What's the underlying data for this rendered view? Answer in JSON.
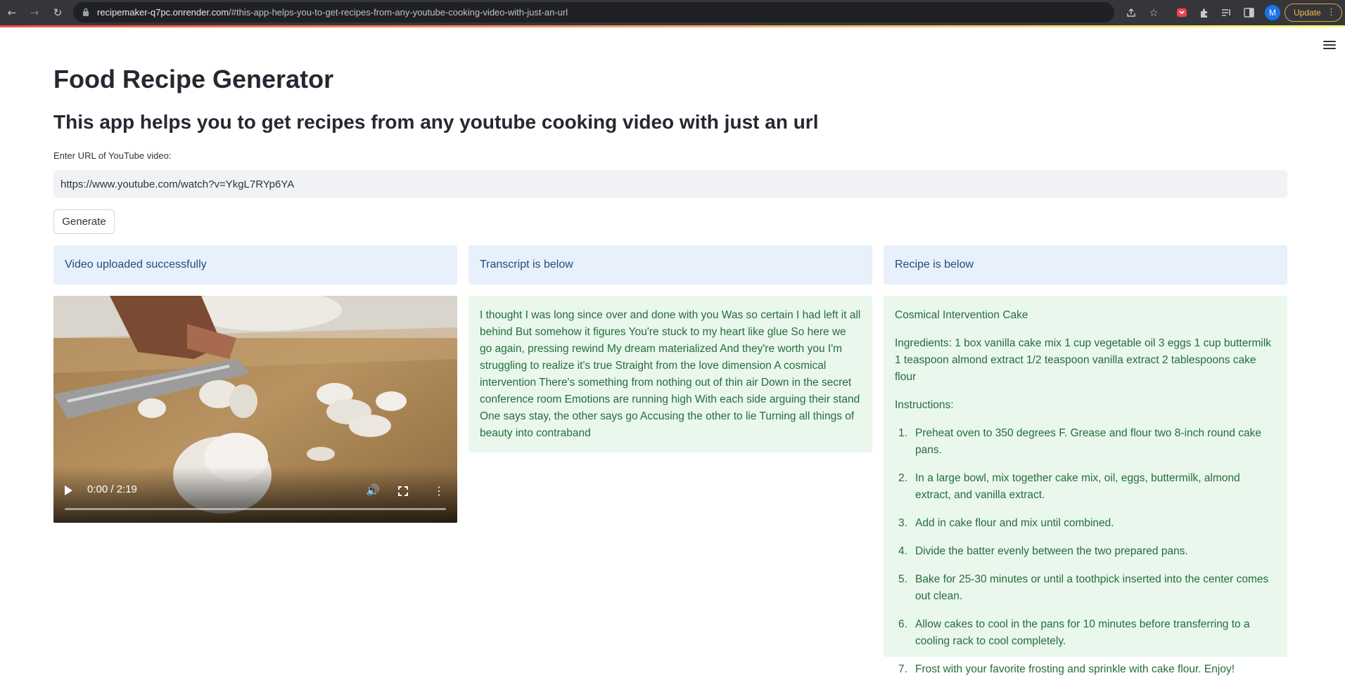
{
  "browser": {
    "url_host": "recipemaker-q7pc.onrender.com",
    "url_path": "/#this-app-helps-you-to-get-recipes-from-any-youtube-cooking-video-with-just-an-url",
    "profile_initial": "M",
    "update_label": "Update"
  },
  "page": {
    "title": "Food Recipe Generator",
    "subtitle": "This app helps you to get recipes from any youtube cooking video with just an url",
    "url_label": "Enter URL of YouTube video:",
    "url_value": "https://www.youtube.com/watch?v=YkgL7RYp6YA",
    "generate_label": "Generate"
  },
  "columns": {
    "video_status": "Video uploaded successfully",
    "transcript_header": "Transcript is below",
    "recipe_header": "Recipe is below"
  },
  "video": {
    "time": "0:00 / 2:19",
    "progress": 0.0
  },
  "transcript": "I thought I was long since over and done with you Was so certain I had left it all behind But somehow it figures You're stuck to my heart like glue So here we go again, pressing rewind My dream materialized And they're worth you I'm struggling to realize it's true Straight from the love dimension A cosmical intervention There's something from nothing out of thin air Down in the secret conference room Emotions are running high With each side arguing their stand One says stay, the other says go Accusing the other to lie Turning all things of beauty into contraband",
  "recipe": {
    "name": "Cosmical Intervention Cake",
    "ingredients": "Ingredients: 1 box vanilla cake mix 1 cup vegetable oil 3 eggs 1 cup buttermilk 1 teaspoon almond extract 1/2 teaspoon vanilla extract 2 tablespoons cake flour",
    "instructions_label": "Instructions:",
    "steps": [
      {
        "num": "1.",
        "text": "Preheat oven to 350 degrees F. Grease and flour two 8-inch round cake pans."
      },
      {
        "num": "2.",
        "text": "In a large bowl, mix together cake mix, oil, eggs, buttermilk, almond extract, and vanilla extract."
      },
      {
        "num": "3.",
        "text": "Add in cake flour and mix until combined."
      },
      {
        "num": "4.",
        "text": "Divide the batter evenly between the two prepared pans."
      },
      {
        "num": "5.",
        "text": "Bake for 25-30 minutes or until a toothpick inserted into the center comes out clean."
      },
      {
        "num": "6.",
        "text": "Allow cakes to cool in the pans for 10 minutes before transferring to a cooling rack to cool completely."
      },
      {
        "num": "7.",
        "text": "Frost with your favorite frosting and sprinkle with cake flour. Enjoy!"
      }
    ]
  },
  "colors": {
    "info_bg": "#e7f0fb",
    "success_bg": "#e9f7ed",
    "success_text": "#256d3c",
    "accent": "#ff4b4b"
  }
}
